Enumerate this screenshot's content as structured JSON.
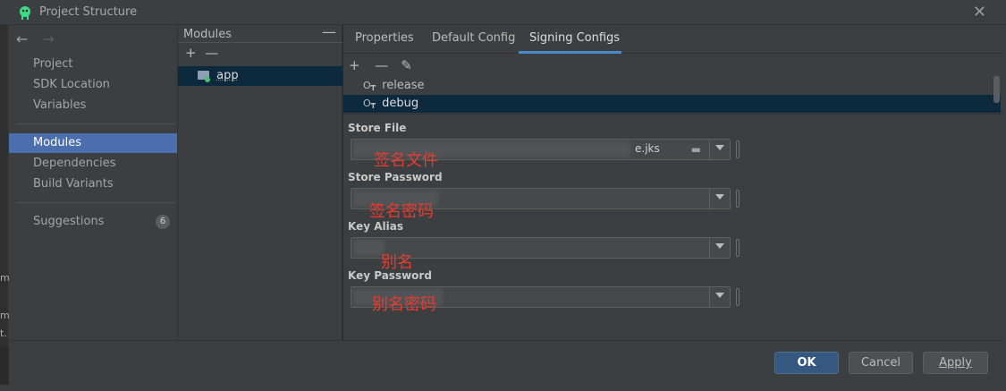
{
  "window": {
    "title": "Project Structure",
    "app_icon": "android-icon",
    "close_glyph": "✕"
  },
  "left_strip": {
    "fragments": [
      "m",
      "m",
      "t."
    ]
  },
  "sidebar": {
    "back_glyph": "←",
    "forward_glyph": "→",
    "group1": [
      {
        "label": "Project"
      },
      {
        "label": "SDK Location"
      },
      {
        "label": "Variables"
      }
    ],
    "group2": [
      {
        "label": "Modules",
        "selected": true
      },
      {
        "label": "Dependencies"
      },
      {
        "label": "Build Variants"
      }
    ],
    "suggestions": {
      "label": "Suggestions",
      "count": "6"
    }
  },
  "modules_panel": {
    "header": "Modules",
    "collapse_glyph": "—",
    "add_glyph": "+",
    "remove_glyph": "—",
    "items": [
      {
        "label": "app"
      }
    ]
  },
  "main": {
    "tabs": [
      {
        "label": "Properties"
      },
      {
        "label": "Default Config"
      },
      {
        "label": "Signing Configs",
        "active": true
      }
    ],
    "toolbar": {
      "add_glyph": "+",
      "remove_glyph": "—",
      "edit_glyph": "✎"
    },
    "configs": [
      {
        "label": "release",
        "icon": "key-icon"
      },
      {
        "label": "debug",
        "icon": "key-icon",
        "selected": true
      }
    ],
    "fields": {
      "store_file": {
        "label": "Store File",
        "value": "e.jks",
        "annotation": "签名文件"
      },
      "store_password": {
        "label": "Store Password",
        "value": "",
        "annotation": "签名密码"
      },
      "key_alias": {
        "label": "Key Alias",
        "value": "",
        "annotation": "别名"
      },
      "key_password": {
        "label": "Key Password",
        "value": "",
        "annotation": "别名密码"
      }
    }
  },
  "buttons": {
    "ok": "OK",
    "cancel": "Cancel",
    "apply": "Apply"
  },
  "colors": {
    "accent": "#4b6eaf",
    "selection": "#0d293e",
    "annotation": "#e83a2f",
    "primary_button": "#365880"
  }
}
